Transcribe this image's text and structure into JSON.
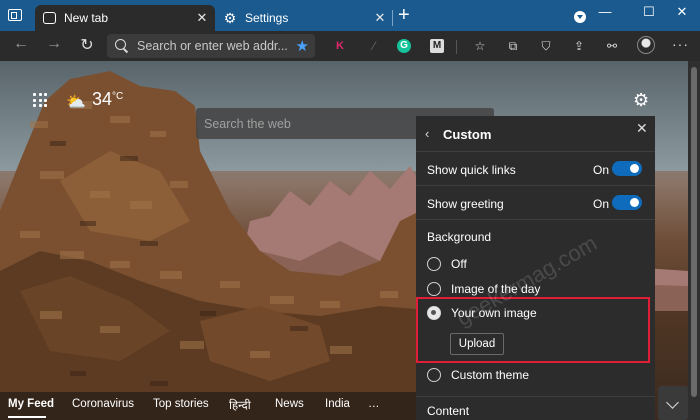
{
  "tabs": [
    {
      "label": "New tab",
      "icon": "new-tab-icon",
      "active": true
    },
    {
      "label": "Settings",
      "icon": "gear-icon",
      "active": false
    }
  ],
  "address_bar": {
    "placeholder": "Search or enter web addr..."
  },
  "page": {
    "temperature": "34",
    "temperature_unit": "°C",
    "search_placeholder": "Search the web",
    "watermark": "geekermag.com"
  },
  "panel": {
    "title": "Custom",
    "show_quick_links": {
      "label": "Show quick links",
      "state": "On"
    },
    "show_greeting": {
      "label": "Show greeting",
      "state": "On"
    },
    "background_label": "Background",
    "options": [
      {
        "label": "Off",
        "checked": false
      },
      {
        "label": "Image of the day",
        "checked": false
      },
      {
        "label": "Your own image",
        "checked": true
      },
      {
        "label": "Custom theme",
        "checked": false
      }
    ],
    "upload_label": "Upload",
    "content_label": "Content"
  },
  "feed": {
    "items": [
      "My Feed",
      "Coronavirus",
      "Top stories",
      "हिन्दी",
      "News",
      "India",
      "…"
    ]
  },
  "colors": {
    "accent": "#0f6cbd",
    "highlight": "#e01e37",
    "titlebar": "#1a5a8e"
  }
}
